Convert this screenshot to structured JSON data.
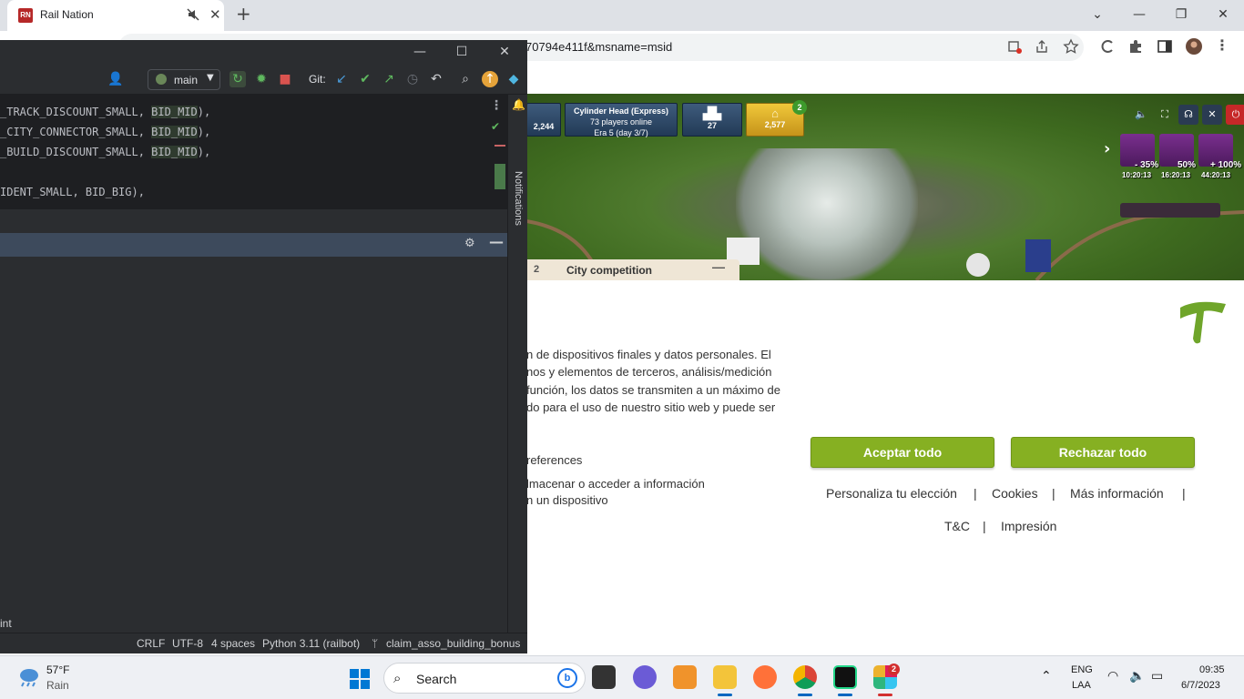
{
  "browser": {
    "tab": {
      "favicon_text": "RN",
      "title": "Rail Nation"
    },
    "new_tab": "+",
    "window_controls": {
      "minimize": "⌄",
      "restore": "—",
      "maximize": "❐",
      "close": "✕"
    },
    "url_visible": "70794e411f&msname=msid"
  },
  "game": {
    "hud": {
      "left_value": "2,244",
      "server_name": "Cylinder Head (Express)",
      "players_online": "73 players online",
      "era": "Era 5 (day 3/7)",
      "rank": "27",
      "gold": "2,577",
      "gold_badge": "2"
    },
    "boosts": [
      {
        "percent": "- 35%",
        "time": "10:20:13"
      },
      {
        "percent": "50%",
        "time": "16:20:13"
      },
      {
        "percent": "+ 100%",
        "time": "44:20:13"
      }
    ],
    "city_competition": {
      "number": "2",
      "label": "City competition",
      "minimize": "—"
    }
  },
  "consent": {
    "text_lines": [
      "n de dispositivos finales y datos personales. El",
      "nos y elementos de terceros, análisis/medición",
      "función, los datos se transmiten a un máximo de",
      "do para el uso de nuestro sitio web y puede ser"
    ],
    "preferences_title": "references",
    "preferences_desc": [
      "lmacenar o acceder a información",
      "n un dispositivo"
    ],
    "accept_label": "Aceptar todo",
    "reject_label": "Rechazar todo",
    "links": {
      "personalize": "Personaliza tu elección",
      "cookies": "Cookies",
      "more_info": "Más información",
      "terms": "T&C",
      "imprint": "Impresión"
    },
    "separator": "|",
    "accent_color": "#86b022"
  },
  "ide": {
    "branch": "main",
    "git_label": "Git:",
    "code_lines": [
      {
        "before": "_TRACK_DISCOUNT_SMALL, ",
        "hl": "BID_MID",
        "after": "),"
      },
      {
        "before": "_CITY_CONNECTOR_SMALL, ",
        "hl": "BID_MID",
        "after": "),"
      },
      {
        "before": "_BUILD_DISCOUNT_SMALL, ",
        "hl": "BID_MID",
        "after": "),"
      },
      {
        "before": "IDENT_SMALL, BID_BIG),",
        "hl": "",
        "after": ""
      }
    ],
    "notifications_label": "Notifications",
    "run_text": "int",
    "status": {
      "line_sep": "CRLF",
      "encoding": "UTF-8",
      "indent": "4 spaces",
      "interpreter": "Python 3.11 (railbot)",
      "branch": "claim_asso_building_bonus"
    }
  },
  "taskbar": {
    "weather_temp": "57°F",
    "weather_cond": "Rain",
    "search_label": "Search",
    "slack_badge": "2",
    "lang_top": "ENG",
    "lang_bottom": "LAA",
    "time": "09:35",
    "date": "6/7/2023"
  }
}
